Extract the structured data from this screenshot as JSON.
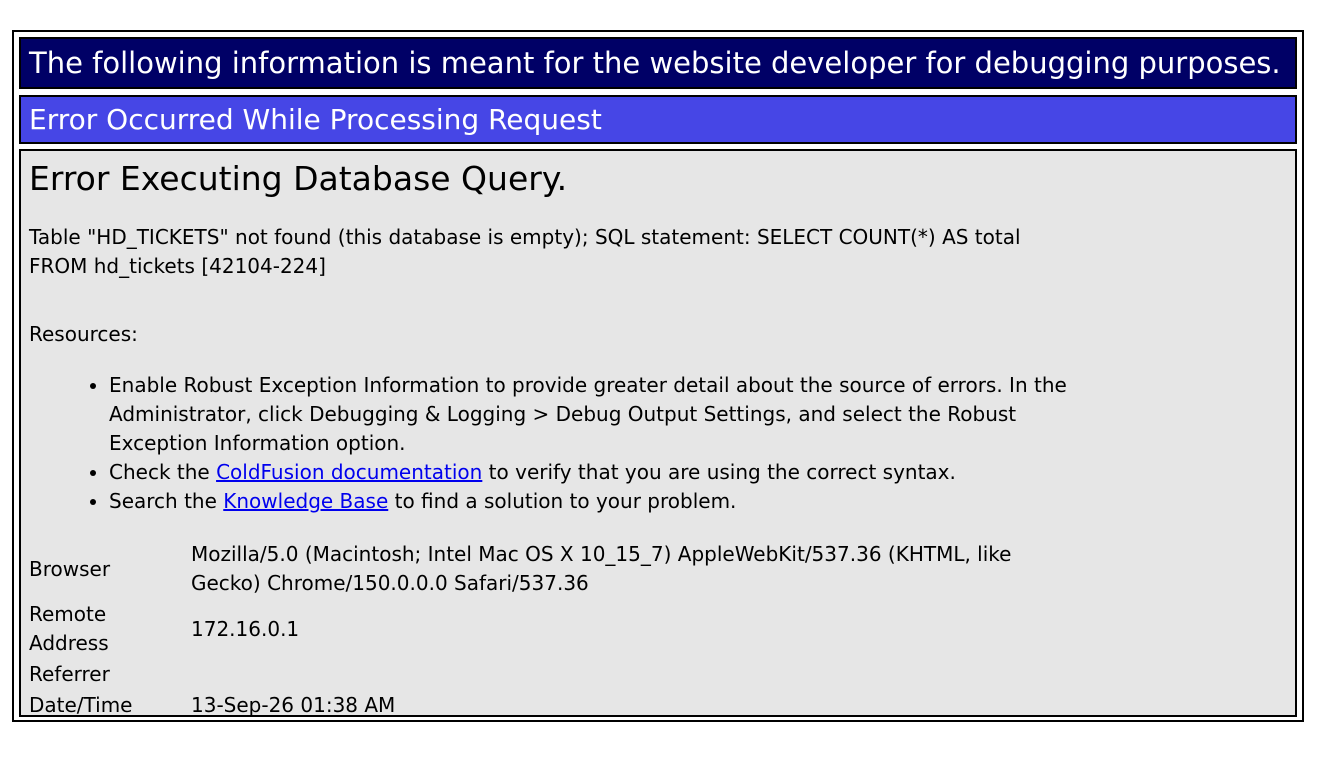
{
  "banner": {
    "text": "The following information is meant for the website developer for debugging purposes."
  },
  "subbanner": {
    "text": "Error Occurred While Processing Request"
  },
  "error": {
    "title": "Error Executing Database Query.",
    "message": "Table \"HD_TICKETS\" not found (this database is empty); SQL statement: SELECT COUNT(*) AS total FROM hd_tickets [42104-224]"
  },
  "resources": {
    "label": "Resources:",
    "item1": "Enable Robust Exception Information to provide greater detail about the source of errors. In the Administrator, click Debugging & Logging > Debug Output Settings, and select the Robust Exception Information option.",
    "item2_prefix": "Check the ",
    "item2_link": "ColdFusion documentation",
    "item2_suffix": " to verify that you are using the correct syntax.",
    "item3_prefix": "Search the ",
    "item3_link": "Knowledge Base",
    "item3_suffix": " to find a solution to your problem."
  },
  "info": {
    "browser_label": "Browser",
    "browser_value": "Mozilla/5.0 (Macintosh; Intel Mac OS X 10_15_7) AppleWebKit/537.36 (KHTML, like Gecko) Chrome/150.0.0.0 Safari/537.36",
    "remote_label": "Remote Address",
    "remote_value": "172.16.0.1",
    "referrer_label": "Referrer",
    "referrer_value": "",
    "datetime_label": "Date/Time",
    "datetime_value": "13-Sep-26 01:38 AM"
  },
  "colors": {
    "banner_bg": "#000066",
    "subbanner_bg": "#4646e6",
    "content_bg": "#e6e6e6",
    "link": "#0000ee"
  }
}
